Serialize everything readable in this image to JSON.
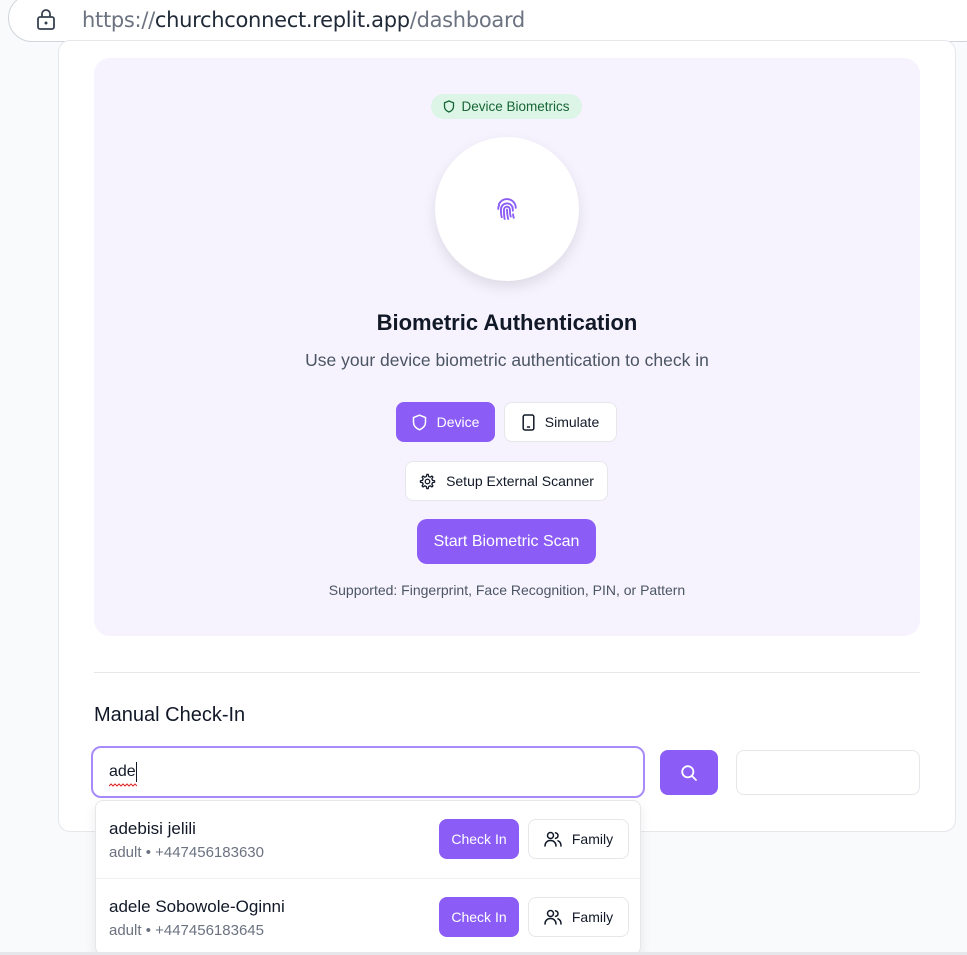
{
  "browser": {
    "url_scheme": "https://",
    "url_host": "churchconnect.replit.app",
    "url_path": "/dashboard"
  },
  "biometric": {
    "badge_label": "Device Biometrics",
    "title": "Biometric Authentication",
    "subtitle": "Use your device biometric authentication to check in",
    "mode_device_label": "Device",
    "mode_simulate_label": "Simulate",
    "setup_scanner_label": "Setup External Scanner",
    "start_scan_label": "Start Biometric Scan",
    "supported_text": "Supported: Fingerprint, Face Recognition, PIN, or Pattern"
  },
  "manual": {
    "title": "Manual Check-In",
    "search_value": "ade",
    "results": [
      {
        "name": "adebisi jelili",
        "meta": "adult • +447456183630",
        "check_in_label": "Check In",
        "family_label": "Family"
      },
      {
        "name": "adele Sobowole-Oginni",
        "meta": "adult • +447456183645",
        "check_in_label": "Check In",
        "family_label": "Family"
      }
    ]
  },
  "colors": {
    "accent": "#8b5cf6",
    "badge_bg": "#dcf5e7",
    "badge_text": "#166534",
    "panel_bg": "#f6f3fe"
  }
}
